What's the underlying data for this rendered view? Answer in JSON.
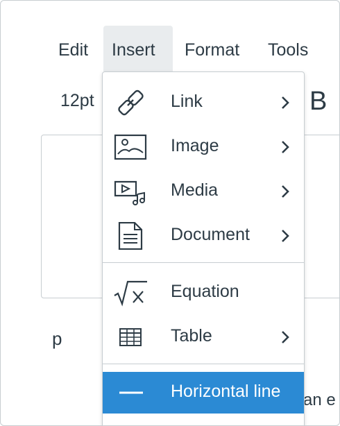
{
  "menubar": {
    "edit": "Edit",
    "insert": "Insert",
    "format": "Format",
    "tools": "Tools"
  },
  "toolbar": {
    "font_size": "12pt",
    "bold_glyph": "B"
  },
  "status": {
    "path": "p"
  },
  "background_text": "an e",
  "insert_menu": {
    "items": [
      {
        "label": "Link",
        "icon": "link-icon",
        "has_submenu": true
      },
      {
        "label": "Image",
        "icon": "image-icon",
        "has_submenu": true
      },
      {
        "label": "Media",
        "icon": "media-icon",
        "has_submenu": true
      },
      {
        "label": "Document",
        "icon": "document-icon",
        "has_submenu": true
      },
      {
        "label": "Equation",
        "icon": "equation-icon",
        "has_submenu": false
      },
      {
        "label": "Table",
        "icon": "table-icon",
        "has_submenu": true
      },
      {
        "label": "Horizontal line",
        "icon": "horizontal-line-icon",
        "has_submenu": false,
        "highlighted": true
      }
    ]
  },
  "colors": {
    "highlight": "#2b8ad4",
    "text": "#2d3b45",
    "active_menu_bg": "#e9ecee",
    "border": "#c7cdd1"
  }
}
